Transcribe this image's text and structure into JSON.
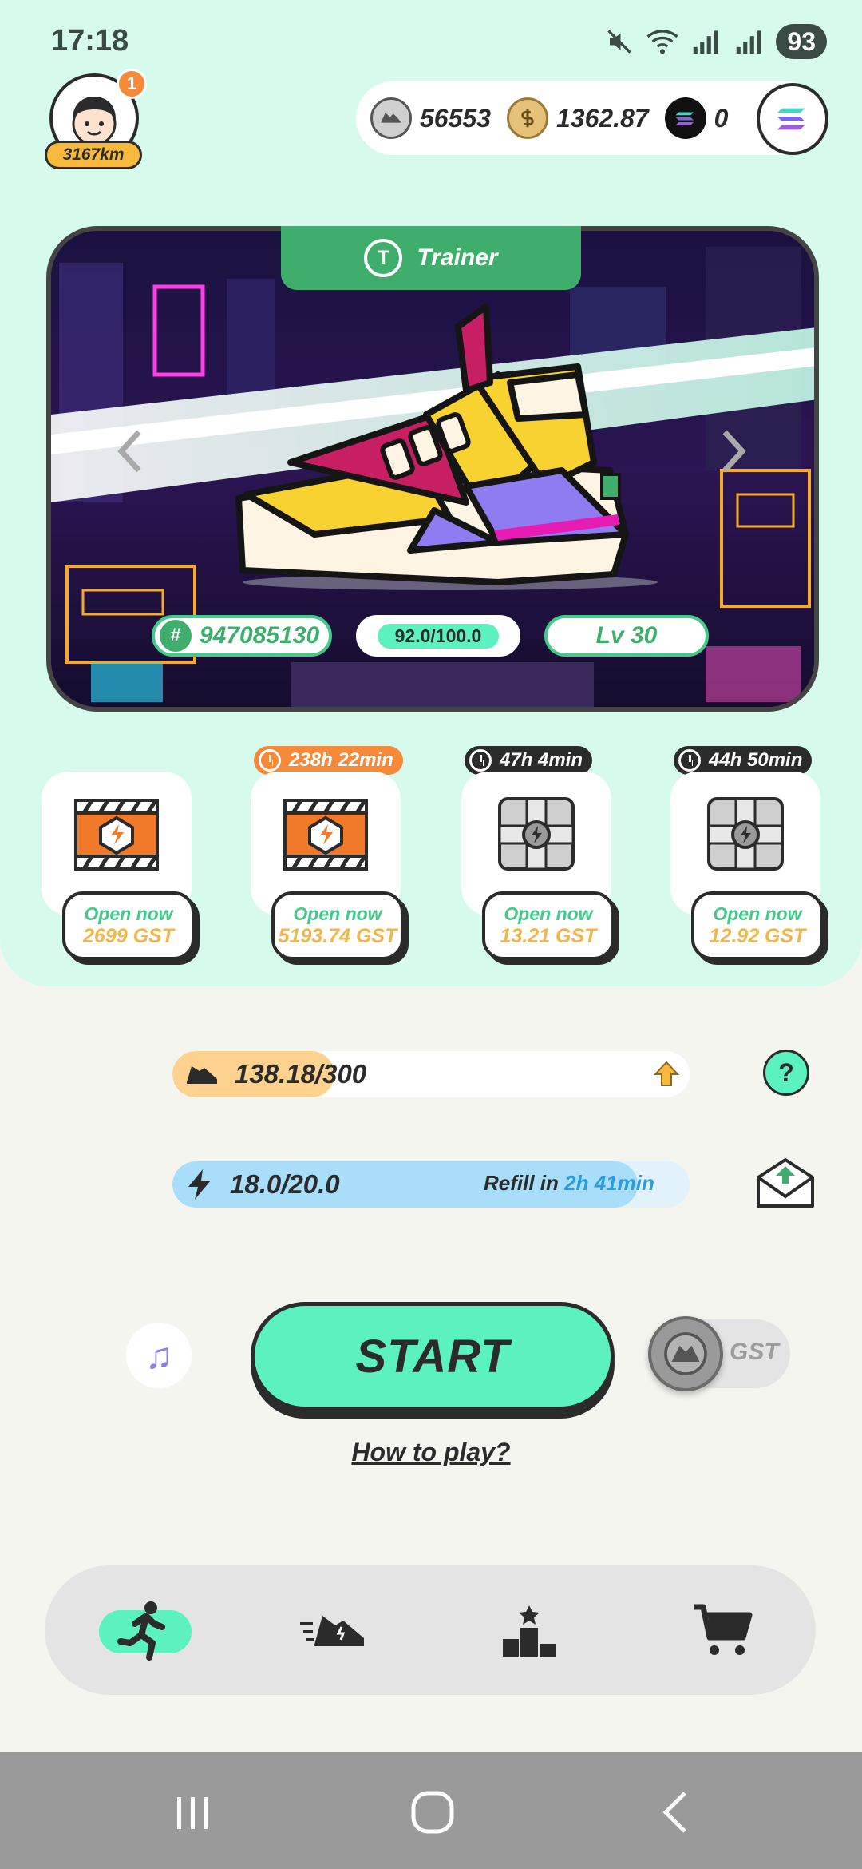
{
  "status_bar": {
    "time": "17:18",
    "battery": "93"
  },
  "profile": {
    "notification_count": "1",
    "distance": "3167km"
  },
  "currencies": {
    "gmt": "56553",
    "gst": "1362.87",
    "sol": "0"
  },
  "sneaker": {
    "type_label": "Trainer",
    "type_initial": "T",
    "id": "947085130",
    "id_symbol": "#",
    "durability": "92.0/100.0",
    "level": "Lv 30",
    "colors": {
      "yellow": "#f8d231",
      "magenta": "#c81e63",
      "purple": "#8e7cf0",
      "cream": "#fdf4e4",
      "pink": "#e81bb4"
    }
  },
  "mystery_boxes": [
    {
      "timer": "",
      "open_label": "Open now",
      "cost": "2699 GST",
      "style": "orange"
    },
    {
      "timer": "238h 22min",
      "timer_color": "#f58a3b",
      "open_label": "Open now",
      "cost": "5193.74 GST",
      "style": "orange"
    },
    {
      "timer": "47h 4min",
      "timer_color": "#2b2b2b",
      "open_label": "Open now",
      "cost": "13.21 GST",
      "style": "grey"
    },
    {
      "timer": "44h 50min",
      "timer_color": "#2b2b2b",
      "open_label": "Open now",
      "cost": "12.92 GST",
      "style": "grey"
    }
  ],
  "mileage": {
    "value": "138.18/300",
    "fraction": 0.46
  },
  "energy": {
    "value": "18.0/20.0",
    "fraction": 0.9,
    "refill_label": "Refill in",
    "refill_time": "2h 41min"
  },
  "help_label": "?",
  "start_label": "START",
  "toggle_label": "GST",
  "how_to_play": "How to play?",
  "nav": {
    "active": "run",
    "items": [
      "run",
      "sneakers",
      "leaderboard",
      "shop"
    ]
  },
  "accent": "#5cf2bf",
  "icons": {
    "avatar": "cartoon-face-icon",
    "gmt": "gmt-token-icon",
    "gst": "gst-token-icon",
    "sol": "solana-icon",
    "music": "music-note-icon"
  }
}
